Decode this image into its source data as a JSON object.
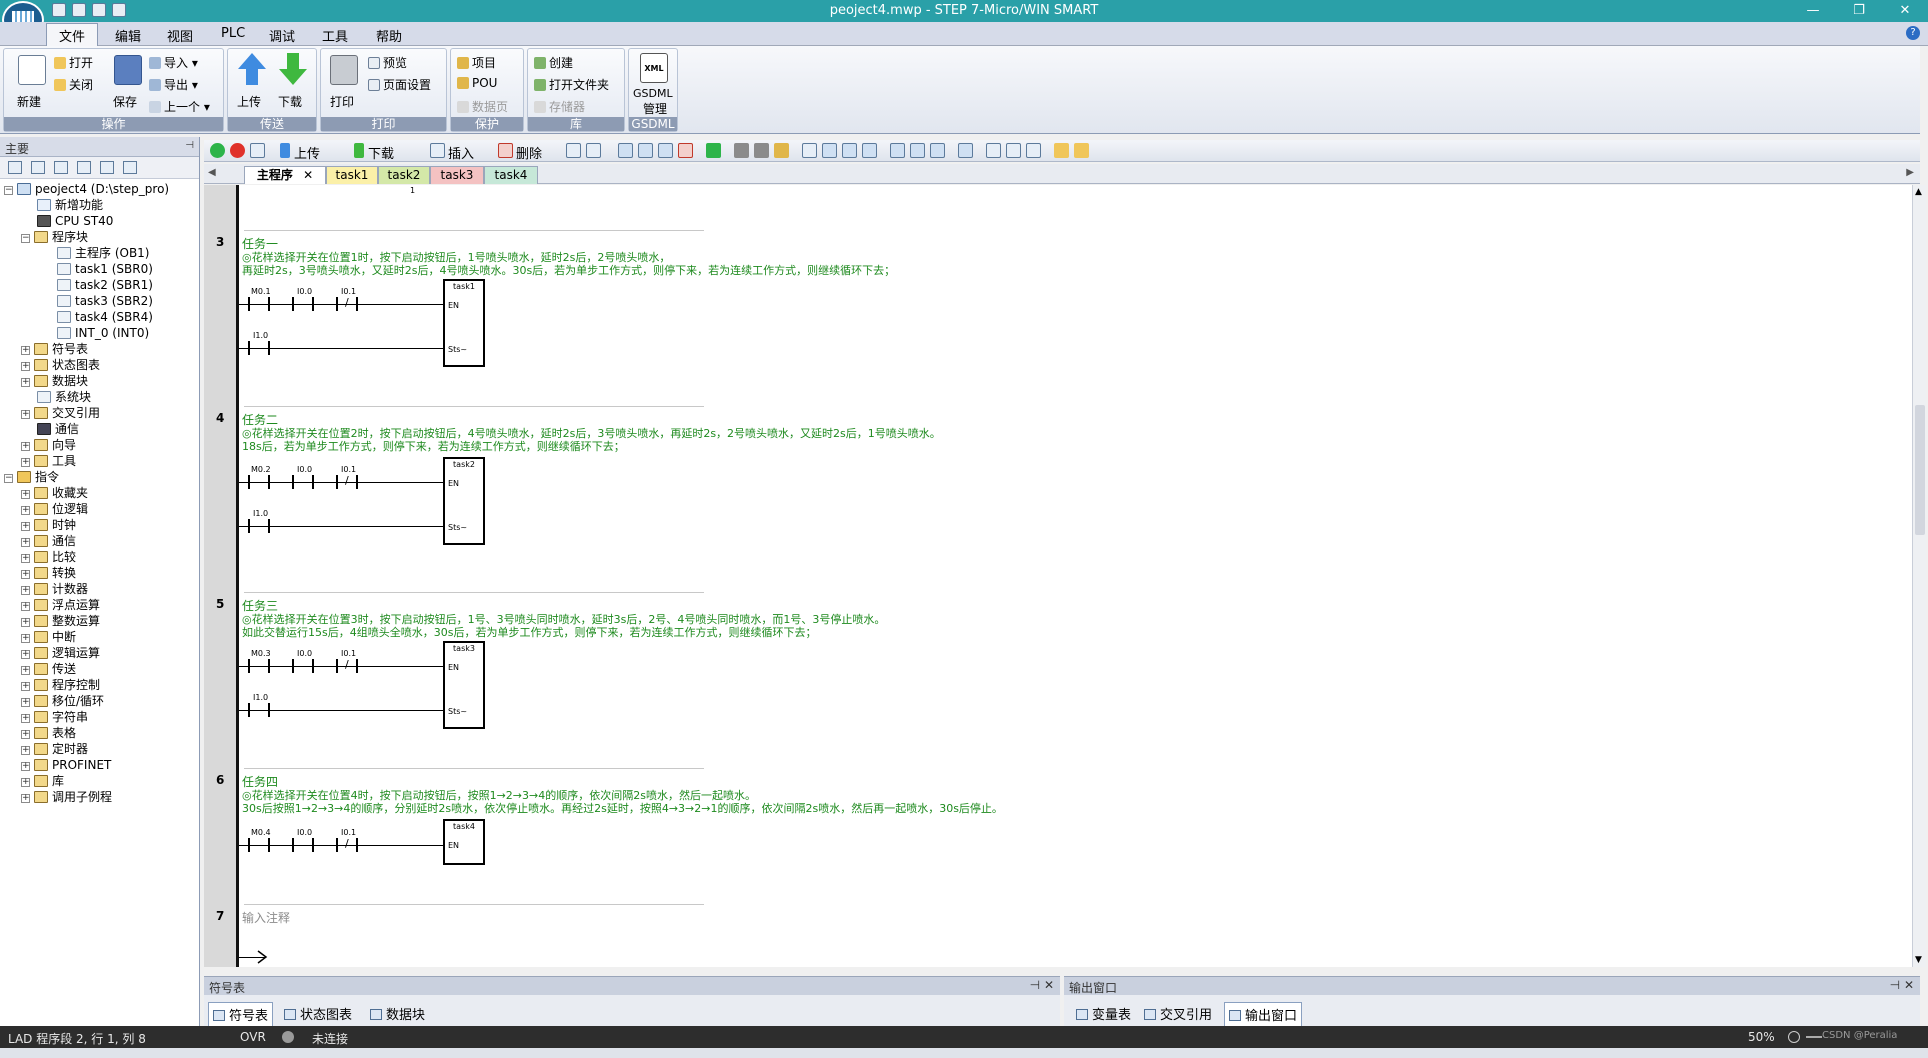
{
  "window": {
    "title": "peoject4.mwp - STEP 7-Micro/WIN SMART"
  },
  "menu": {
    "items": [
      "文件",
      "编辑",
      "视图",
      "PLC",
      "调试",
      "工具",
      "帮助"
    ]
  },
  "ribbon": {
    "new": "新建",
    "open": "打开",
    "close": "关闭",
    "save": "保存",
    "import": "导入",
    "export": "导出",
    "previous": "上一个",
    "group_ops": "操作",
    "upload": "上传",
    "download": "下载",
    "group_transfer": "传送",
    "print": "打印",
    "preview": "预览",
    "page_setup": "页面设置",
    "group_print": "打印",
    "project": "项目",
    "pou": "POU",
    "data_page": "数据页",
    "group_protect": "保护",
    "create": "创建",
    "open_folder": "打开文件夹",
    "memory_card": "存储器",
    "group_library": "库",
    "gsdml_line1": "GSDML",
    "gsdml_line2": "管理",
    "group_gsdml": "GSDML",
    "xml_icon_text": "XML"
  },
  "left_panel": {
    "title": "主要",
    "tree": {
      "project": "peoject4 (D:\\step_pro)",
      "new_features": "新增功能",
      "cpu": "CPU ST40",
      "program_block": "程序块",
      "programs": [
        "主程序 (OB1)",
        "task1 (SBR0)",
        "task2 (SBR1)",
        "task3 (SBR2)",
        "task4 (SBR4)",
        "INT_0 (INT0)"
      ],
      "project_items": [
        "符号表",
        "状态图表",
        "数据块",
        "系统块",
        "交叉引用",
        "通信",
        "向导",
        "工具"
      ],
      "instructions": "指令",
      "instruction_items": [
        "收藏夹",
        "位逻辑",
        "时钟",
        "通信",
        "比较",
        "转换",
        "计数器",
        "浮点运算",
        "整数运算",
        "中断",
        "逻辑运算",
        "传送",
        "程序控制",
        "移位/循环",
        "字符串",
        "表格",
        "定时器",
        "PROFINET",
        "库",
        "调用子例程"
      ]
    }
  },
  "editor_toolbar": {
    "upload": "上传",
    "download": "下载",
    "insert": "插入",
    "delete": "删除"
  },
  "tabs": [
    "主程序",
    "task1",
    "task2",
    "task3",
    "task4"
  ],
  "editor": {
    "top_marker": "1",
    "rungs": [
      {
        "num": "3",
        "title": "任务一",
        "comment1": "◎花样选择开关在位置1时，按下启动按钮后，1号喷头喷水，延时2s后，2号喷头喷水，",
        "comment2": "再延时2s，3号喷头喷水，又延时2s后，4号喷头喷水。30s后，若为单步工作方式，则停下来，若为连续工作方式，则继续循环下去；",
        "c1": "M0.1",
        "c2": "I0.0",
        "c3": "I0.1",
        "c4": "I1.0",
        "fn": "task1",
        "en": "EN",
        "sts": "Sts~"
      },
      {
        "num": "4",
        "title": "任务二",
        "comment1": "◎花样选择开关在位置2时，按下启动按钮后，4号喷头喷水，延时2s后，3号喷头喷水，再延时2s，2号喷头喷水，又延时2s后，1号喷头喷水。",
        "comment2": "18s后，若为单步工作方式，则停下来，若为连续工作方式，则继续循环下去；",
        "c1": "M0.2",
        "c2": "I0.0",
        "c3": "I0.1",
        "c4": "I1.0",
        "fn": "task2",
        "en": "EN",
        "sts": "Sts~"
      },
      {
        "num": "5",
        "title": "任务三",
        "comment1": "◎花样选择开关在位置3时，按下启动按钮后，1号、3号喷头同时喷水，延时3s后，2号、4号喷头同时喷水，而1号、3号停止喷水。",
        "comment2": "如此交替运行15s后，4组喷头全喷水，30s后，若为单步工作方式，则停下来，若为连续工作方式，则继续循环下去；",
        "c1": "M0.3",
        "c2": "I0.0",
        "c3": "I0.1",
        "c4": "I1.0",
        "fn": "task3",
        "en": "EN",
        "sts": "Sts~"
      },
      {
        "num": "6",
        "title": "任务四",
        "comment1": "◎花样选择开关在位置4时，按下启动按钮后，按照1→2→3→4的顺序，依次间隔2s喷水，然后一起喷水。",
        "comment2": "30s后按照1→2→3→4的顺序，分别延时2s喷水，依次停止喷水。再经过2s延时，按照4→3→2→1的顺序，依次间隔2s喷水，然后再一起喷水，30s后停止。",
        "c1": "M0.4",
        "c2": "I0.0",
        "c3": "I0.1",
        "fn": "task4",
        "en": "EN"
      }
    ],
    "rung7": {
      "num": "7",
      "placeholder": "输入注释"
    }
  },
  "bottom": {
    "symbol_pane_title": "符号表",
    "symbol_tabs": [
      "符号表",
      "状态图表",
      "数据块"
    ],
    "output_pane_title": "输出窗口",
    "output_tabs": [
      "变量表",
      "交叉引用",
      "输出窗口"
    ]
  },
  "status": {
    "position": "LAD 程序段 2, 行 1, 列 8",
    "mode": "OVR",
    "connection": "未连接",
    "zoom": "50%",
    "watermark": "CSDN @Peralia"
  }
}
